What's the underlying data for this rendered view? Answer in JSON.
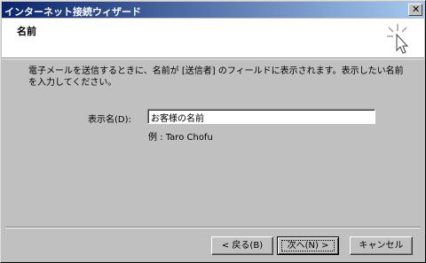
{
  "window": {
    "title": "インターネット接続ウィザード",
    "close_symbol": "✕"
  },
  "header": {
    "title": "名前",
    "icon": "wizard-icon"
  },
  "body": {
    "description": "電子メールを送信するときに、名前が [送信者] のフィールドに表示されます。表示したい名前を入力してください。",
    "display_name_label": "表示名(D):",
    "display_name_value": "お客様の名前",
    "example": "例 : Taro Chofu"
  },
  "buttons": {
    "back": "< 戻る(B)",
    "next": "次へ(N) >",
    "cancel": "キャンセル"
  }
}
